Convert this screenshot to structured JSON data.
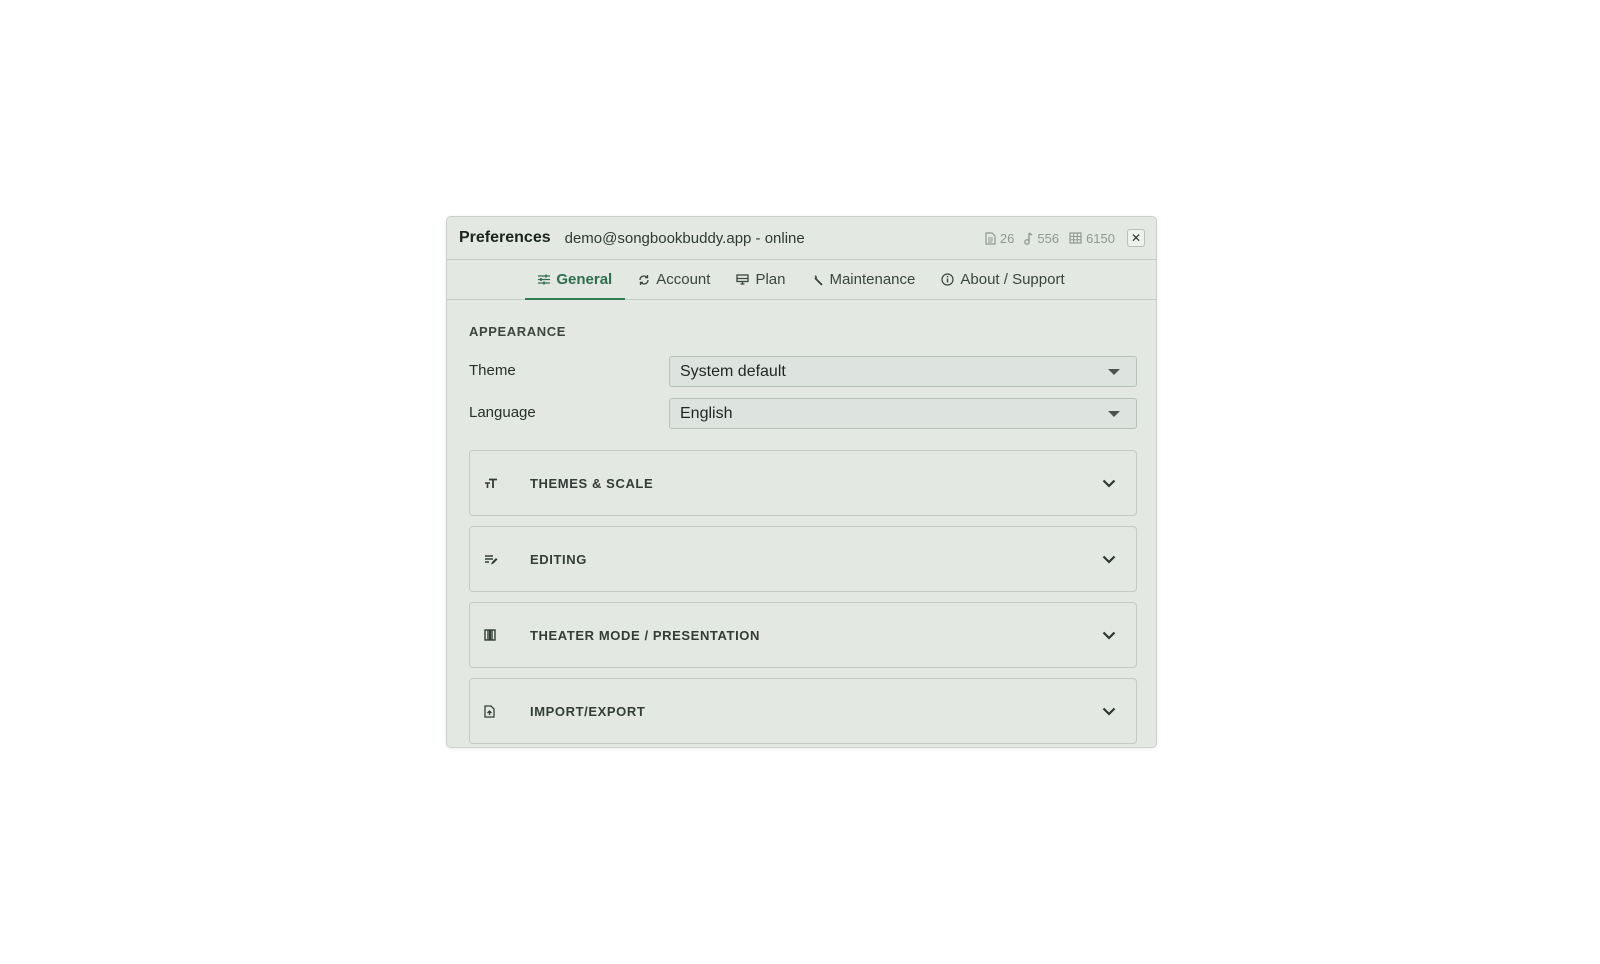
{
  "header": {
    "title": "Preferences",
    "account_status": "demo@songbookbuddy.app - online",
    "stats": [
      {
        "icon": "document-icon",
        "value": "26"
      },
      {
        "icon": "music-note-icon",
        "value": "556"
      },
      {
        "icon": "table-icon",
        "value": "6150"
      }
    ],
    "close_label": "✕"
  },
  "tabs": [
    {
      "icon": "sliders-icon",
      "label": "General",
      "active": true
    },
    {
      "icon": "sync-icon",
      "label": "Account",
      "active": false
    },
    {
      "icon": "monitor-icon",
      "label": "Plan",
      "active": false
    },
    {
      "icon": "wrench-icon",
      "label": "Maintenance",
      "active": false
    },
    {
      "icon": "info-icon",
      "label": "About / Support",
      "active": false
    }
  ],
  "appearance": {
    "section_title": "APPEARANCE",
    "theme": {
      "label": "Theme",
      "value": "System default"
    },
    "language": {
      "label": "Language",
      "value": "English"
    }
  },
  "panels": [
    {
      "icon": "text-size-icon",
      "title": "THEMES & SCALE"
    },
    {
      "icon": "edit-lines-icon",
      "title": "EDITING"
    },
    {
      "icon": "theater-icon",
      "title": "THEATER MODE / PRESENTATION"
    },
    {
      "icon": "file-import-icon",
      "title": "IMPORT/EXPORT"
    }
  ],
  "colors": {
    "accent": "#2e7d55",
    "background": "#e3e8e3"
  }
}
